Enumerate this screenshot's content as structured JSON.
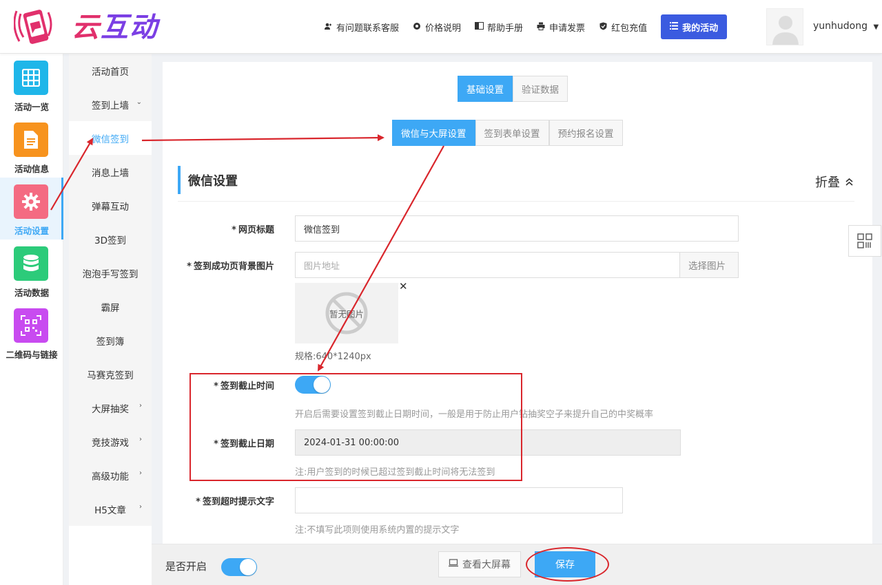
{
  "brand": {
    "logo_text_1": "云",
    "logo_text_2": "互动"
  },
  "topnav": {
    "items": [
      {
        "label": "有问题联系客服",
        "icon": "user-plus-icon"
      },
      {
        "label": "价格说明",
        "icon": "gear-icon"
      },
      {
        "label": "帮助手册",
        "icon": "book-icon"
      },
      {
        "label": "申请发票",
        "icon": "printer-icon"
      },
      {
        "label": "红包充值",
        "icon": "shield-check-icon"
      }
    ],
    "my_activity": "我的活动",
    "username": "yunhudong"
  },
  "icon_sidebar": {
    "items": [
      {
        "label": "活动一览",
        "icon": "grid-icon",
        "color": "#1fb6e9"
      },
      {
        "label": "活动信息",
        "icon": "document-icon",
        "color": "#f7931e"
      },
      {
        "label": "活动设置",
        "icon": "gear-icon",
        "color": "#f46b82"
      },
      {
        "label": "活动数据",
        "icon": "database-icon",
        "color": "#2ccb7a"
      },
      {
        "label": "二维码与链接",
        "icon": "qrcode-icon",
        "color": "#c84bf0"
      }
    ],
    "active_index": 2
  },
  "sub_sidebar": {
    "items": [
      {
        "label": "活动首页",
        "chevron": ""
      },
      {
        "label": "签到上墙",
        "chevron": "⌄"
      },
      {
        "label": "微信签到",
        "chevron": ""
      },
      {
        "label": "消息上墙",
        "chevron": ""
      },
      {
        "label": "弹幕互动",
        "chevron": ""
      },
      {
        "label": "3D签到",
        "chevron": ""
      },
      {
        "label": "泡泡手写签到",
        "chevron": ""
      },
      {
        "label": "霸屏",
        "chevron": ""
      },
      {
        "label": "签到簿",
        "chevron": ""
      },
      {
        "label": "马赛克签到",
        "chevron": ""
      },
      {
        "label": "大屏抽奖",
        "chevron": "›"
      },
      {
        "label": "竞技游戏",
        "chevron": "›"
      },
      {
        "label": "高级功能",
        "chevron": "›"
      },
      {
        "label": "H5文章",
        "chevron": "›"
      }
    ],
    "active_index": 2
  },
  "tabs_primary": [
    {
      "label": "基础设置",
      "active": true
    },
    {
      "label": "验证数据",
      "active": false
    }
  ],
  "tabs_secondary": [
    {
      "label": "微信与大屏设置",
      "active": true
    },
    {
      "label": "签到表单设置",
      "active": false
    },
    {
      "label": "预约报名设置",
      "active": false
    }
  ],
  "section": {
    "title": "微信设置",
    "fold_label": "折叠"
  },
  "form": {
    "page_title": {
      "label": "网页标题",
      "value": "微信签到"
    },
    "bg_image": {
      "label": "签到成功页背景图片",
      "placeholder": "图片地址",
      "choose_label": "选择图片",
      "no_image": "暂无图片",
      "spec": "规格:640*1240px"
    },
    "deadline_toggle": {
      "label": "签到截止时间",
      "on": true,
      "help": "开启后需要设置签到截止日期时间，一般是用于防止用户钻抽奖空子来提升自己的中奖概率"
    },
    "deadline_date": {
      "label": "签到截止日期",
      "value": "2024-01-31 00:00:00",
      "help": "注:用户签到的时候已超过签到截止时间将无法签到"
    },
    "timeout_text": {
      "label": "签到超时提示文字",
      "value": "",
      "help": "注:不填写此项则使用系统内置的提示文字"
    },
    "required_mark": "*"
  },
  "footer": {
    "enable_label": "是否开启",
    "enabled": true,
    "preview_label": "查看大屏幕",
    "save_label": "保存"
  },
  "colors": {
    "accent": "#3da8f5",
    "annotation_red": "#d9262c",
    "primary_button": "#3b5be0"
  }
}
